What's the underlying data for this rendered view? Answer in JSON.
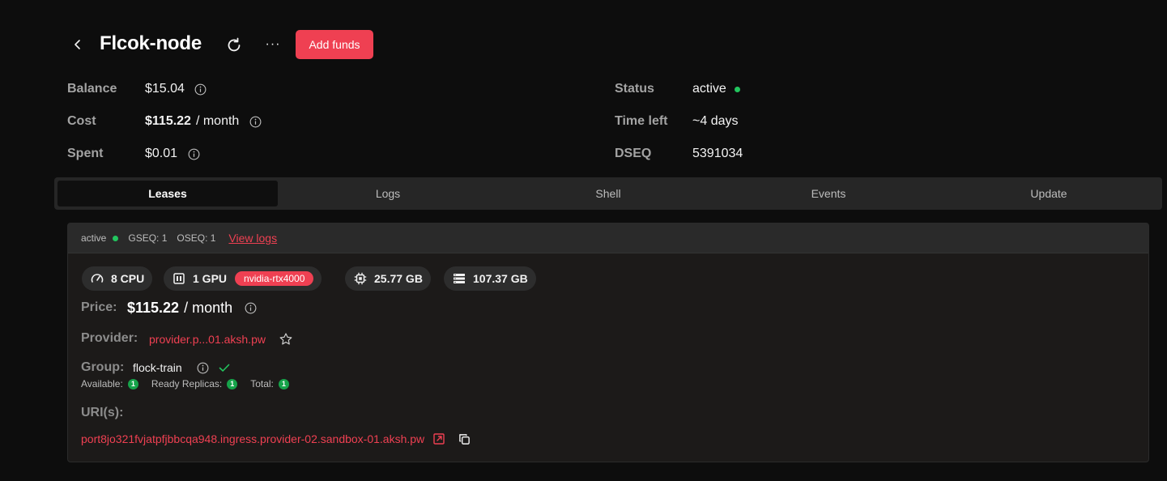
{
  "header": {
    "title": "Flcok-node",
    "add_funds_label": "Add funds",
    "more_label": "···"
  },
  "info": {
    "balance_label": "Balance",
    "balance_value": "$15.04",
    "cost_label": "Cost",
    "cost_value": "$115.22",
    "cost_unit": "/ month",
    "spent_label": "Spent",
    "spent_value": "$0.01",
    "status_label": "Status",
    "status_value": "active",
    "time_left_label": "Time left",
    "time_left_value": "~4 days",
    "dseq_label": "DSEQ",
    "dseq_value": "5391034"
  },
  "tabs": [
    {
      "label": "Leases",
      "active": true
    },
    {
      "label": "Logs",
      "active": false
    },
    {
      "label": "Shell",
      "active": false
    },
    {
      "label": "Events",
      "active": false
    },
    {
      "label": "Update",
      "active": false
    }
  ],
  "lease": {
    "status": "active",
    "gseq": "GSEQ: 1",
    "oseq": "OSEQ: 1",
    "view_logs": "View logs",
    "cpu": "8 CPU",
    "gpu": "1 GPU",
    "gpu_model": "nvidia-rtx4000",
    "memory": "25.77 GB",
    "storage": "107.37 GB",
    "price_label": "Price:",
    "price_value": "$115.22",
    "price_unit": "/ month",
    "provider_label": "Provider:",
    "provider_value": "provider.p...01.aksh.pw",
    "group_label": "Group:",
    "group_value": "flock-train",
    "available_label": "Available:",
    "available_count": "1",
    "ready_label": "Ready Replicas:",
    "ready_count": "1",
    "total_label": "Total:",
    "total_count": "1",
    "uris_label": "URI(s):",
    "uri": "port8jo321fvjatpfjbbcqa948.ingress.provider-02.sandbox-01.aksh.pw"
  },
  "colors": {
    "accent": "#ef4052",
    "status_green": "#22c55e",
    "background": "#0d0d0d"
  },
  "icons": [
    "chevron-left-icon",
    "refresh-icon",
    "more-icon",
    "info-icon",
    "cpu-gauge-icon",
    "gpu-icon",
    "memory-chip-icon",
    "storage-icon",
    "star-icon",
    "check-icon",
    "external-link-icon",
    "copy-icon"
  ]
}
